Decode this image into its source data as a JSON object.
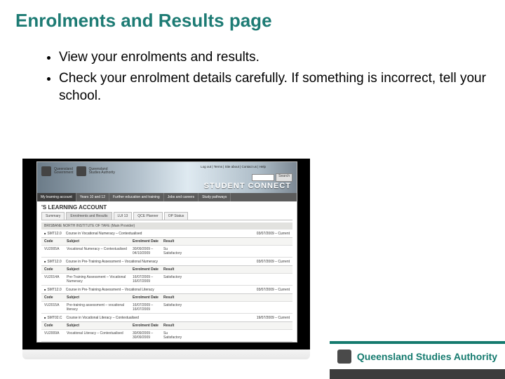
{
  "slide": {
    "title": "Enrolments and Results page",
    "bullets": [
      "View your enrolments and results.",
      "Check your enrolment details carefully. If something is incorrect, tell your school."
    ]
  },
  "screenshot": {
    "crest_line1": "Queensland",
    "crest_line2": "Government",
    "crest_line3": "Queensland",
    "crest_line4": "Studies Authority",
    "qsa_label": "Queensland Studies Authority",
    "top_links": "Log out | Terms | Site about | Contact us | Help",
    "search_btn": "Search",
    "big_title": "STUDENT CONNECT",
    "nav": {
      "items": [
        "My learning account",
        "Years 10 and 12",
        "Further education and training",
        "Jobs and careers",
        "Study pathways"
      ]
    },
    "page_title": "'S LEARNING ACCOUNT",
    "sub_tabs": [
      "Summary",
      "Enrolments and Results",
      "LUI 13",
      "QCE Planner",
      "OP Status"
    ],
    "section_bar_left": "BRISBANE NORTH INSTITUTE OF TAFE (Main Provider)",
    "groups": [
      {
        "course_code": "SMT12.0",
        "course_title": "Course in Vocational Numeracy – Contextualised",
        "course_dates": "03/07/2009 – Current",
        "headers": [
          "Code",
          "Subject",
          "Enrolment Date",
          "Result"
        ],
        "rows": [
          [
            "VU2005A",
            "Vocational Numeracy – Contextualised",
            "30/09/2009 – 04/10/2009",
            "Su Satisfactory"
          ]
        ]
      },
      {
        "course_code": "SMT12.0",
        "course_title": "Course in Pre-Training Assessment – Vocational Numeracy",
        "course_dates": "03/07/2009 – Current",
        "headers": [
          "Code",
          "Subject",
          "Enrolment Date",
          "Result"
        ],
        "rows": [
          [
            "VU2014A",
            "Pre-Training Assessment – Vocational Numeracy",
            "16/07/2009 – 16/07/2009",
            "Satisfactory"
          ]
        ]
      },
      {
        "course_code": "SMT12.0",
        "course_title": "Course in Pre-Training Assessment – Vocational Literacy",
        "course_dates": "03/07/2009 – Current",
        "headers": [
          "Code",
          "Subject",
          "Enrolment Date",
          "Result"
        ],
        "rows": [
          [
            "VU2015A",
            "Pre-training assessment – vocational literacy",
            "16/07/2009 – 16/07/2009",
            "Satisfactory"
          ]
        ]
      },
      {
        "course_code": "SMT02.C",
        "course_title": "Course in Vocational Literacy – Contextualised",
        "course_dates": "19/07/2009 – Current",
        "headers": [
          "Code",
          "Subject",
          "Enrolment Date",
          "Result"
        ],
        "rows": [
          [
            "VU2009A",
            "Vocational Literacy – Contextualised",
            "30/09/2009 – 30/09/2009",
            "Su Satisfactory"
          ]
        ]
      }
    ]
  },
  "footer": {
    "brand": "Queensland Studies Authority"
  }
}
